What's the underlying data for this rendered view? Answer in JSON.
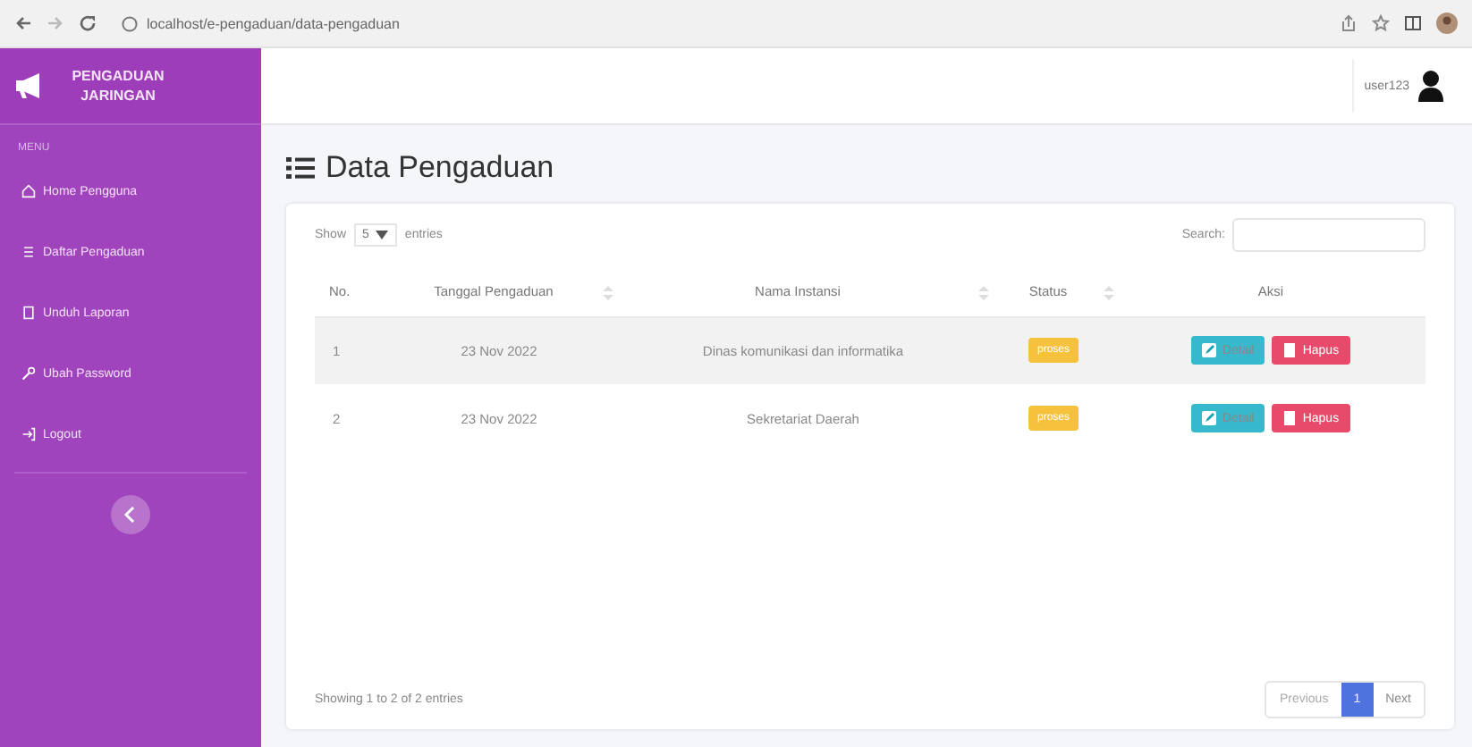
{
  "browser": {
    "url": "localhost/e-pengaduan/data-pengaduan"
  },
  "brand": {
    "title": "PENGADUAN JARINGAN"
  },
  "sidebar": {
    "heading": "MENU",
    "items": [
      {
        "label": "Home Pengguna",
        "kind": "home",
        "selected": false
      },
      {
        "label": "Daftar Pengaduan",
        "kind": "list",
        "selected": false
      },
      {
        "label": "Unduh Laporan",
        "kind": "file",
        "selected": false
      },
      {
        "label": "Ubah Password",
        "kind": "key",
        "selected": false
      },
      {
        "label": "Logout",
        "kind": "exit",
        "selected": false
      }
    ]
  },
  "topbar": {
    "user": "user123"
  },
  "page": {
    "title": "Data Pengaduan"
  },
  "table_controls": {
    "show_label": "Show",
    "page_size": "5",
    "entries_label": "entries",
    "search_label": "Search:"
  },
  "table": {
    "columns": [
      "No.",
      "Tanggal Pengaduan",
      "Nama Instansi",
      "Status",
      "Aksi"
    ],
    "rows": [
      {
        "no": "1",
        "date": "23 Nov 2022",
        "agency": "Dinas komunikasi dan informatika",
        "status": "proses",
        "actions": [
          "Detail",
          "Hapus"
        ]
      },
      {
        "no": "2",
        "date": "23 Nov 2022",
        "agency": "Sekretariat Daerah",
        "status": "proses",
        "actions": [
          "Detail",
          "Hapus"
        ]
      }
    ]
  },
  "footer": {
    "info": "Showing 1 to 2 of 2 entries",
    "pagination": [
      {
        "label": "Previous",
        "kind": "prev",
        "selected": false
      },
      {
        "label": "1",
        "kind": "page",
        "selected": true
      },
      {
        "label": "Next",
        "kind": "next",
        "selected": false
      }
    ]
  }
}
